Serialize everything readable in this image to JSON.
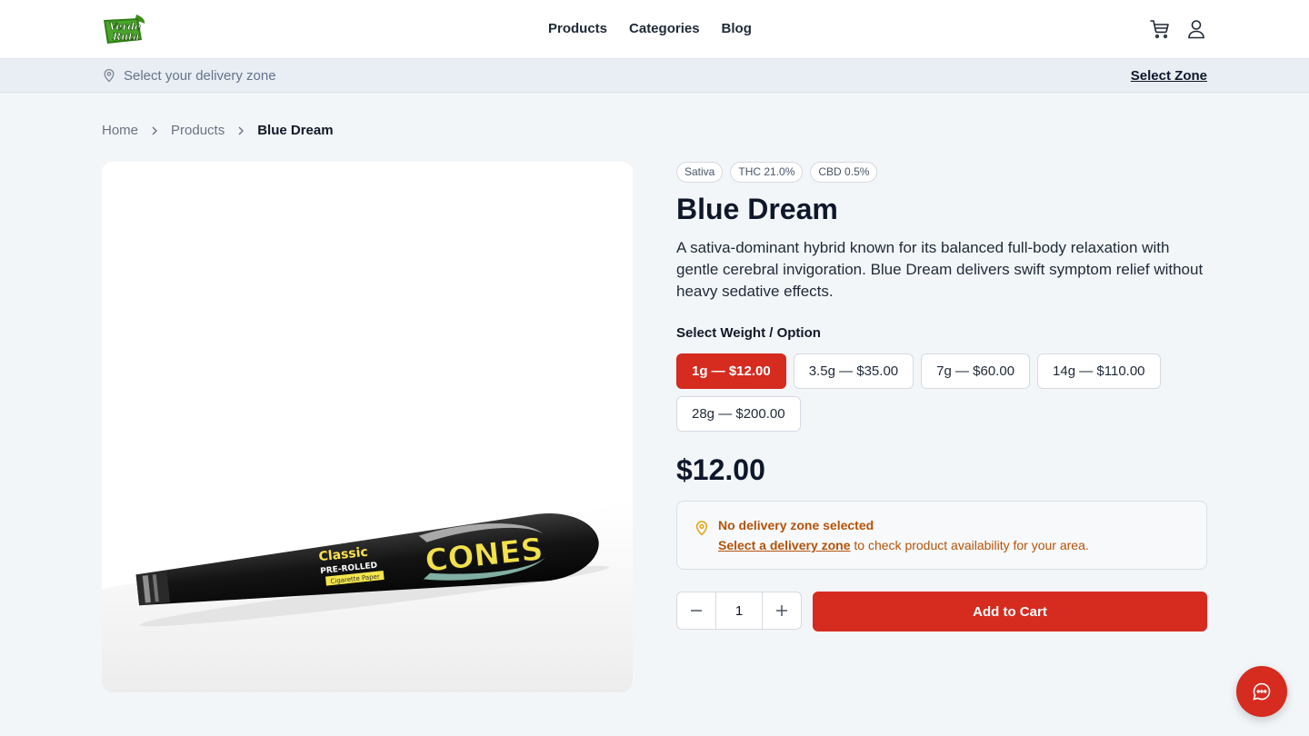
{
  "header": {
    "logo_icon": "verde-ruta-logo",
    "logo_text": "Verde Ruta",
    "nav": [
      {
        "label": "Products"
      },
      {
        "label": "Categories"
      },
      {
        "label": "Blog"
      }
    ],
    "cart_icon": "cart-icon",
    "user_icon": "user-icon"
  },
  "zone_bar": {
    "pin_icon": "map-pin-icon",
    "text": "Select your delivery zone",
    "link_label": "Select Zone"
  },
  "breadcrumb": {
    "items": [
      "Home",
      "Products"
    ],
    "current": "Blue Dream",
    "separator_icon": "chevron-right-icon"
  },
  "product": {
    "image_alt": "Classic pre-rolled cone",
    "image_text": {
      "brand": "Classic",
      "subline": "PRE-ROLLED",
      "tag": "Cigarette Paper",
      "cones": "CONES"
    },
    "badges": [
      "Sativa",
      "THC 21.0%",
      "CBD 0.5%"
    ],
    "name": "Blue Dream",
    "description": "A sativa-dominant hybrid known for its balanced full-body relaxation with gentle cerebral invigoration. Blue Dream delivers swift symptom relief without heavy sedative effects.",
    "option_label": "Select Weight / Option",
    "options": [
      {
        "label": "1g — $12.00",
        "selected": true
      },
      {
        "label": "3.5g — $35.00",
        "selected": false
      },
      {
        "label": "7g — $60.00",
        "selected": false
      },
      {
        "label": "14g — $110.00",
        "selected": false
      },
      {
        "label": "28g — $200.00",
        "selected": false
      }
    ],
    "price": "$12.00"
  },
  "notice": {
    "icon": "map-pin-icon",
    "title": "No delivery zone selected",
    "link_text": "Select a delivery zone",
    "body_text": " to check product availability for your area."
  },
  "cart": {
    "quantity": "1",
    "minus_icon": "minus-icon",
    "plus_icon": "plus-icon",
    "add_label": "Add to Cart"
  },
  "chat": {
    "icon": "chat-bubble-icon"
  },
  "colors": {
    "accent": "#d62b1f",
    "warning": "#b45309",
    "background": "#f3f6f9"
  }
}
